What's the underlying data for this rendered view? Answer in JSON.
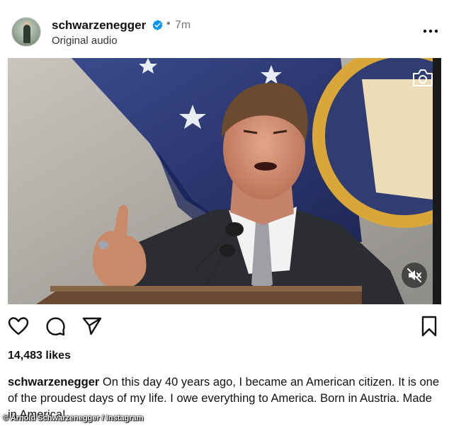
{
  "post": {
    "username": "schwarzenegger",
    "time": "7m",
    "separator": "•",
    "audio": "Original audio",
    "likes": "14,483 likes",
    "caption": "On this day 40 years ago, I became an American citizen. It is one of the proudest days of my life. I owe everything to America. Born in Austria. Made in America!"
  },
  "credit": "© Arnold Schwarzenegger / Instagram",
  "icons": {
    "verified": "verified-badge-icon",
    "more": "more-options-icon",
    "camera": "camera-icon",
    "mute": "muted-speaker-icon",
    "like": "heart-icon",
    "comment": "comment-bubble-icon",
    "share": "paper-plane-icon",
    "save": "bookmark-icon"
  },
  "colors": {
    "verified": "#0095f6",
    "text": "#111111",
    "muted": "#777777"
  }
}
